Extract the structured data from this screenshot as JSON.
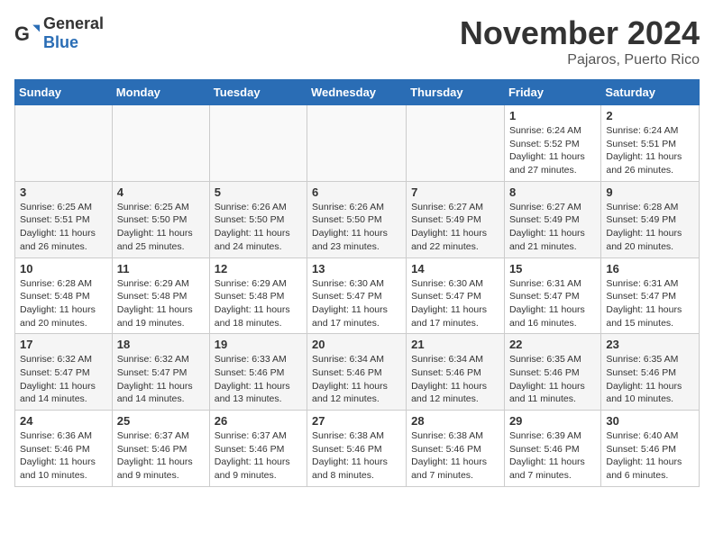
{
  "header": {
    "logo_general": "General",
    "logo_blue": "Blue",
    "month_title": "November 2024",
    "location": "Pajaros, Puerto Rico"
  },
  "weekdays": [
    "Sunday",
    "Monday",
    "Tuesday",
    "Wednesday",
    "Thursday",
    "Friday",
    "Saturday"
  ],
  "weeks": [
    [
      {
        "day": "",
        "info": ""
      },
      {
        "day": "",
        "info": ""
      },
      {
        "day": "",
        "info": ""
      },
      {
        "day": "",
        "info": ""
      },
      {
        "day": "",
        "info": ""
      },
      {
        "day": "1",
        "info": "Sunrise: 6:24 AM\nSunset: 5:52 PM\nDaylight: 11 hours and 27 minutes."
      },
      {
        "day": "2",
        "info": "Sunrise: 6:24 AM\nSunset: 5:51 PM\nDaylight: 11 hours and 26 minutes."
      }
    ],
    [
      {
        "day": "3",
        "info": "Sunrise: 6:25 AM\nSunset: 5:51 PM\nDaylight: 11 hours and 26 minutes."
      },
      {
        "day": "4",
        "info": "Sunrise: 6:25 AM\nSunset: 5:50 PM\nDaylight: 11 hours and 25 minutes."
      },
      {
        "day": "5",
        "info": "Sunrise: 6:26 AM\nSunset: 5:50 PM\nDaylight: 11 hours and 24 minutes."
      },
      {
        "day": "6",
        "info": "Sunrise: 6:26 AM\nSunset: 5:50 PM\nDaylight: 11 hours and 23 minutes."
      },
      {
        "day": "7",
        "info": "Sunrise: 6:27 AM\nSunset: 5:49 PM\nDaylight: 11 hours and 22 minutes."
      },
      {
        "day": "8",
        "info": "Sunrise: 6:27 AM\nSunset: 5:49 PM\nDaylight: 11 hours and 21 minutes."
      },
      {
        "day": "9",
        "info": "Sunrise: 6:28 AM\nSunset: 5:49 PM\nDaylight: 11 hours and 20 minutes."
      }
    ],
    [
      {
        "day": "10",
        "info": "Sunrise: 6:28 AM\nSunset: 5:48 PM\nDaylight: 11 hours and 20 minutes."
      },
      {
        "day": "11",
        "info": "Sunrise: 6:29 AM\nSunset: 5:48 PM\nDaylight: 11 hours and 19 minutes."
      },
      {
        "day": "12",
        "info": "Sunrise: 6:29 AM\nSunset: 5:48 PM\nDaylight: 11 hours and 18 minutes."
      },
      {
        "day": "13",
        "info": "Sunrise: 6:30 AM\nSunset: 5:47 PM\nDaylight: 11 hours and 17 minutes."
      },
      {
        "day": "14",
        "info": "Sunrise: 6:30 AM\nSunset: 5:47 PM\nDaylight: 11 hours and 17 minutes."
      },
      {
        "day": "15",
        "info": "Sunrise: 6:31 AM\nSunset: 5:47 PM\nDaylight: 11 hours and 16 minutes."
      },
      {
        "day": "16",
        "info": "Sunrise: 6:31 AM\nSunset: 5:47 PM\nDaylight: 11 hours and 15 minutes."
      }
    ],
    [
      {
        "day": "17",
        "info": "Sunrise: 6:32 AM\nSunset: 5:47 PM\nDaylight: 11 hours and 14 minutes."
      },
      {
        "day": "18",
        "info": "Sunrise: 6:32 AM\nSunset: 5:47 PM\nDaylight: 11 hours and 14 minutes."
      },
      {
        "day": "19",
        "info": "Sunrise: 6:33 AM\nSunset: 5:46 PM\nDaylight: 11 hours and 13 minutes."
      },
      {
        "day": "20",
        "info": "Sunrise: 6:34 AM\nSunset: 5:46 PM\nDaylight: 11 hours and 12 minutes."
      },
      {
        "day": "21",
        "info": "Sunrise: 6:34 AM\nSunset: 5:46 PM\nDaylight: 11 hours and 12 minutes."
      },
      {
        "day": "22",
        "info": "Sunrise: 6:35 AM\nSunset: 5:46 PM\nDaylight: 11 hours and 11 minutes."
      },
      {
        "day": "23",
        "info": "Sunrise: 6:35 AM\nSunset: 5:46 PM\nDaylight: 11 hours and 10 minutes."
      }
    ],
    [
      {
        "day": "24",
        "info": "Sunrise: 6:36 AM\nSunset: 5:46 PM\nDaylight: 11 hours and 10 minutes."
      },
      {
        "day": "25",
        "info": "Sunrise: 6:37 AM\nSunset: 5:46 PM\nDaylight: 11 hours and 9 minutes."
      },
      {
        "day": "26",
        "info": "Sunrise: 6:37 AM\nSunset: 5:46 PM\nDaylight: 11 hours and 9 minutes."
      },
      {
        "day": "27",
        "info": "Sunrise: 6:38 AM\nSunset: 5:46 PM\nDaylight: 11 hours and 8 minutes."
      },
      {
        "day": "28",
        "info": "Sunrise: 6:38 AM\nSunset: 5:46 PM\nDaylight: 11 hours and 7 minutes."
      },
      {
        "day": "29",
        "info": "Sunrise: 6:39 AM\nSunset: 5:46 PM\nDaylight: 11 hours and 7 minutes."
      },
      {
        "day": "30",
        "info": "Sunrise: 6:40 AM\nSunset: 5:46 PM\nDaylight: 11 hours and 6 minutes."
      }
    ]
  ]
}
